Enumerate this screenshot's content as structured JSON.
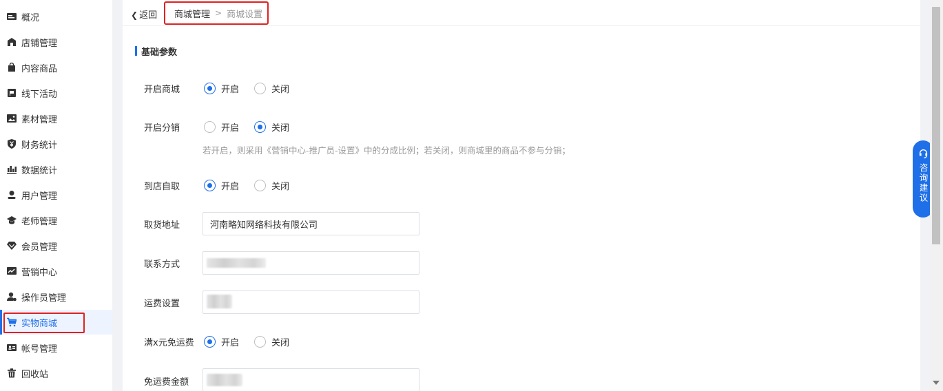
{
  "sidebar": {
    "items": [
      {
        "label": "概况",
        "icon": "overview-icon"
      },
      {
        "label": "店铺管理",
        "icon": "store-icon"
      },
      {
        "label": "内容商品",
        "icon": "bag-icon"
      },
      {
        "label": "线下活动",
        "icon": "flag-icon"
      },
      {
        "label": "素材管理",
        "icon": "image-icon"
      },
      {
        "label": "财务统计",
        "icon": "yuan-shield-icon"
      },
      {
        "label": "数据统计",
        "icon": "bar-chart-icon"
      },
      {
        "label": "用户管理",
        "icon": "user-icon"
      },
      {
        "label": "老师管理",
        "icon": "graduation-cap-icon"
      },
      {
        "label": "会员管理",
        "icon": "diamond-icon"
      },
      {
        "label": "营销中心",
        "icon": "trend-chart-icon"
      },
      {
        "label": "操作员管理",
        "icon": "operator-icon"
      },
      {
        "label": "实物商城",
        "icon": "cart-icon",
        "active": true
      },
      {
        "label": "帐号管理",
        "icon": "id-card-icon"
      },
      {
        "label": "回收站",
        "icon": "trash-icon"
      }
    ]
  },
  "topbar": {
    "back_label": "返回",
    "breadcrumb": [
      "商城管理",
      "商城设置"
    ],
    "separator": ">"
  },
  "section": {
    "title": "基础参数"
  },
  "form": {
    "open_mall": {
      "label": "开启商城",
      "options": [
        "开启",
        "关闭"
      ],
      "selected": "开启"
    },
    "open_distribution": {
      "label": "开启分销",
      "options": [
        "开启",
        "关闭"
      ],
      "selected": "关闭",
      "hint": "若开启，则采用《营销中心-推广员-设置》中的分成比例；若关闭，则商城里的商品不参与分销；"
    },
    "self_pickup": {
      "label": "到店自取",
      "options": [
        "开启",
        "关闭"
      ],
      "selected": "开启"
    },
    "pickup_address": {
      "label": "取货地址",
      "value": "河南略知网络科技有限公司"
    },
    "contact": {
      "label": "联系方式",
      "value": ""
    },
    "shipping_fee": {
      "label": "运费设置",
      "value": ""
    },
    "free_shipping": {
      "label": "满x元免运费",
      "options": [
        "开启",
        "关闭"
      ],
      "selected": "开启"
    },
    "free_amount": {
      "label": "免运费金额",
      "value": ""
    }
  },
  "consult_button": {
    "label": "咨询建议"
  },
  "colors": {
    "accent": "#1e6fe8",
    "highlight_border": "#e02020"
  }
}
